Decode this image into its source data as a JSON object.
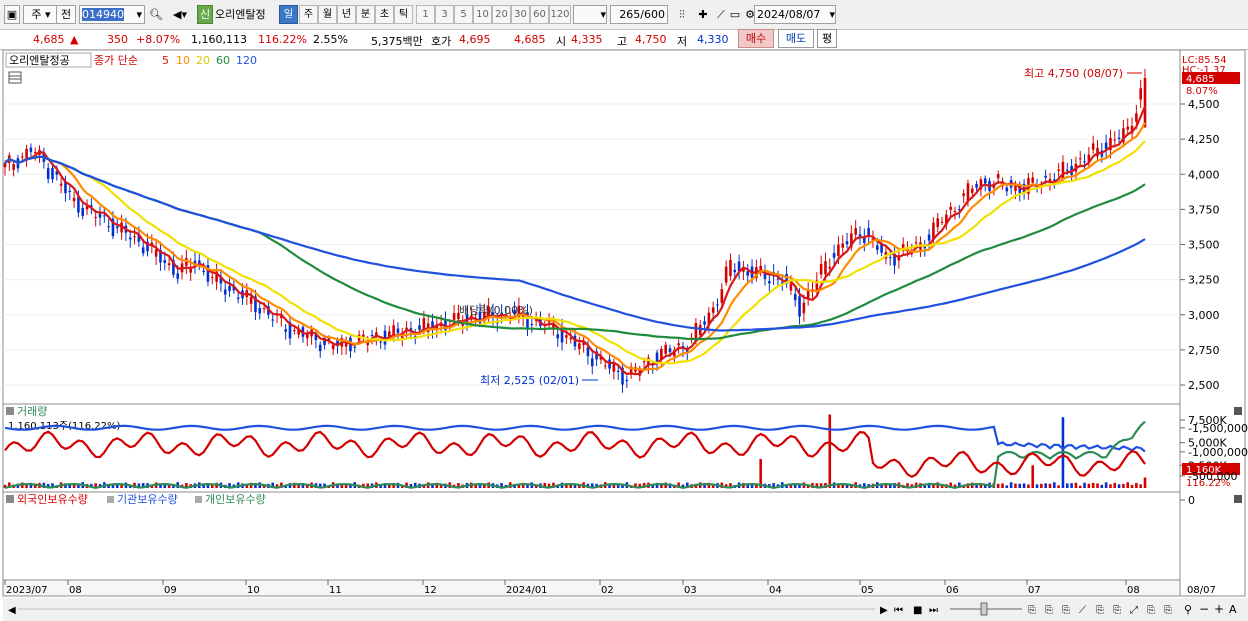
{
  "toolbar": {
    "market": "주",
    "prev": "전",
    "code": "014940",
    "new_badge": "신",
    "stock_name": "오리엔탈정",
    "periods": [
      "일",
      "주",
      "월",
      "년",
      "분",
      "초",
      "틱"
    ],
    "active_period": "일",
    "numbers": [
      "1",
      "3",
      "5",
      "10",
      "20",
      "30",
      "60",
      "120"
    ],
    "count": "265",
    "count_total": "/600",
    "date": "2024/08/07"
  },
  "info": {
    "price": "4,685",
    "arrow": "▲",
    "change": "350",
    "change_pct": "+8.07%",
    "volume": "1,160,113",
    "volume_pct": "116.22%",
    "turnover": "2.55%",
    "amount": "5,375백만",
    "quote_label": "호가",
    "ask": "4,695",
    "bid": "4,685",
    "open_label": "시",
    "open": "4,335",
    "high_label": "고",
    "high": "4,750",
    "low_label": "저",
    "low": "4,330",
    "buy_btn": "매수",
    "sell_btn": "매도",
    "avg_btn": "평"
  },
  "price_panel": {
    "stock_label": "오리엔탈정공",
    "ma_label": "종가 단순",
    "ma_periods": [
      "5",
      "10",
      "20",
      "60",
      "120"
    ],
    "ma_colors": [
      "#d81818",
      "#ff8c00",
      "#f2e000",
      "#1e8c3c",
      "#2050e0"
    ],
    "lc_label": "LC:85.54",
    "hc_label": "HC:-1.37",
    "current_price_label": "4,685",
    "current_pct_label": "8.07%",
    "high_annot": "최고 4,750 (08/07)",
    "low_annot": "최저 2,525 (02/01)",
    "div_annot": "배당락(0.00%)",
    "y_ticks": [
      "4,500",
      "4,250",
      "4,000",
      "3,750",
      "3,500",
      "3,250",
      "3,000",
      "2,750",
      "2,500"
    ]
  },
  "volume_panel": {
    "title": "거래량",
    "value_label": "1,160,113주(116.22%)",
    "y_ticks": [
      "7,500K",
      "5,000K",
      "2,500K"
    ],
    "current_label": "1,160K",
    "current_pct": "116.22%"
  },
  "holdings_panel": {
    "series": [
      {
        "name": "외국인보유수량",
        "color": "#d40000"
      },
      {
        "name": "기관보유수량",
        "color": "#2050e0"
      },
      {
        "name": "개인보유수량",
        "color": "#2e8b57"
      }
    ],
    "y_ticks": [
      "0",
      "-500,000",
      "-1,000,000",
      "-1,500,000"
    ]
  },
  "x_axis": {
    "labels": [
      "2023/07",
      "08",
      "09",
      "10",
      "11",
      "12",
      "2024/01",
      "02",
      "03",
      "04",
      "05",
      "06",
      "07",
      "08"
    ],
    "end_date": "08/07"
  }
}
